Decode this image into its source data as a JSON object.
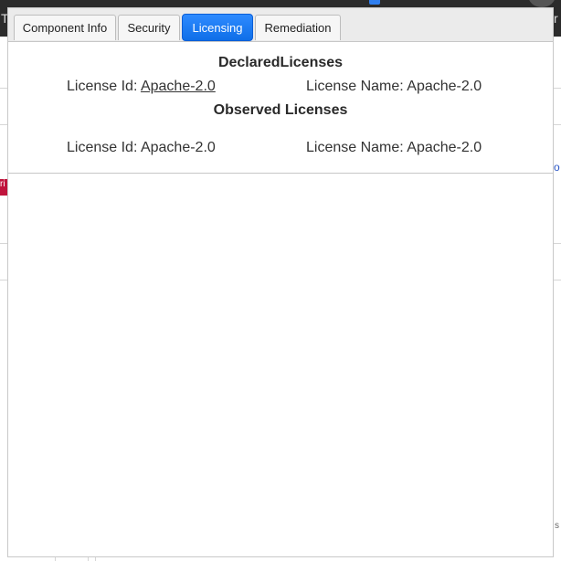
{
  "background": {
    "topbar_left_text": "T",
    "topbar_right_text": "r",
    "red_badge_text": "ri",
    "right_link_text": "o",
    "right_small_text": "s"
  },
  "tabs": [
    {
      "label": "Component Info",
      "active": false
    },
    {
      "label": "Security",
      "active": false
    },
    {
      "label": "Licensing",
      "active": true
    },
    {
      "label": "Remediation",
      "active": false
    }
  ],
  "licensing": {
    "declared": {
      "title": "DeclaredLicenses",
      "id_label": "License Id: ",
      "id_value": "Apache-2.0",
      "name_label": "License Name: ",
      "name_value": "Apache-2.0"
    },
    "observed": {
      "title": "Observed Licenses",
      "id_label": "License Id: ",
      "id_value": "Apache-2.0",
      "name_label": "License Name: ",
      "name_value": "Apache-2.0"
    }
  },
  "colors": {
    "active_tab": "#1a73e8",
    "badge_red": "#c0143c"
  }
}
